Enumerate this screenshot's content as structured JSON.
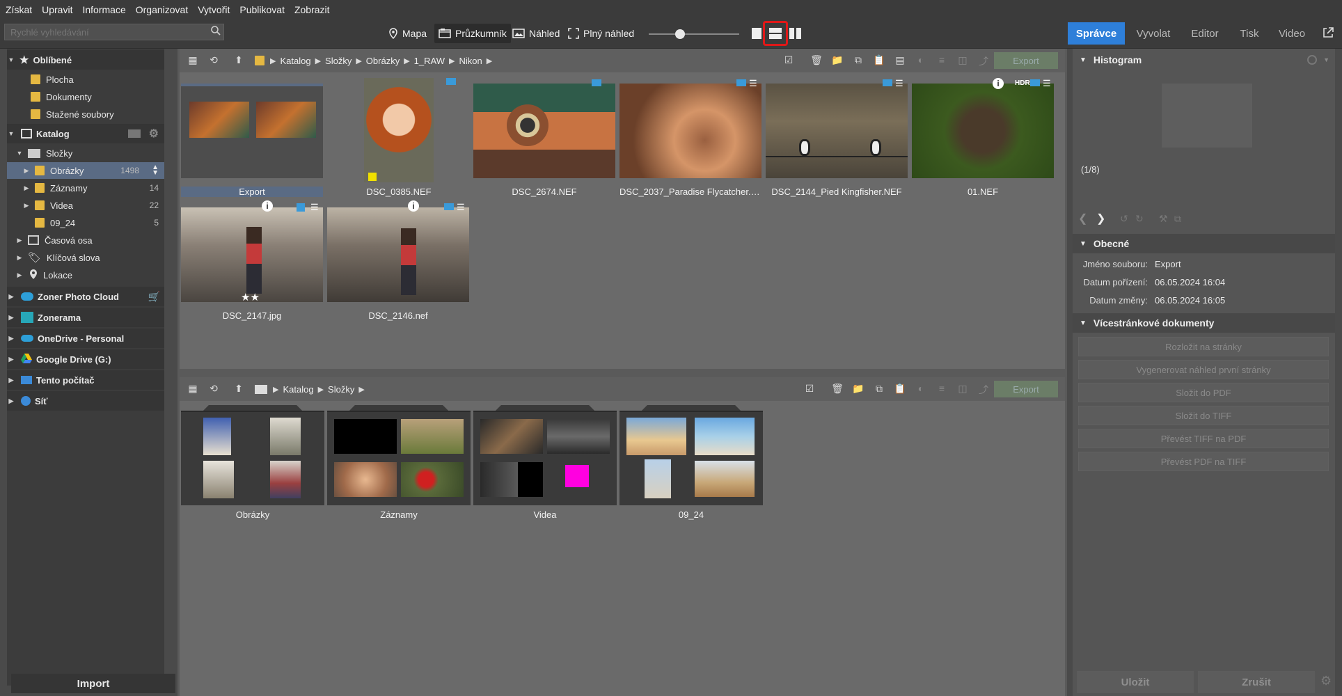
{
  "menu": [
    "Získat",
    "Upravit",
    "Informace",
    "Organizovat",
    "Vytvořit",
    "Publikovat",
    "Zobrazit"
  ],
  "search": {
    "placeholder": "Rychlé vyhledávání"
  },
  "modes": {
    "map": "Mapa",
    "explorer": "Průzkumník",
    "preview": "Náhled",
    "fullpreview": "Plný náhled"
  },
  "right_tabs": {
    "manager": "Správce",
    "develop": "Vyvolat",
    "editor": "Editor",
    "print": "Tisk",
    "video": "Video"
  },
  "sidebar": {
    "favorites": "Oblíbené",
    "fav_items": [
      "Plocha",
      "Dokumenty",
      "Stažené soubory"
    ],
    "catalog": "Katalog",
    "folders": "Složky",
    "images": "Obrázky",
    "images_count": "1498",
    "records": "Záznamy",
    "records_count": "14",
    "videos": "Videa",
    "videos_count": "22",
    "folder0924": "09_24",
    "folder0924_count": "5",
    "timeline": "Časová osa",
    "keywords": "Klíčová slova",
    "locations": "Lokace",
    "cloud": "Zoner Photo Cloud",
    "zonerama": "Zonerama",
    "onedrive": "OneDrive - Personal",
    "gdrive": "Google Drive (G:)",
    "thispc": "Tento počítač",
    "network": "Síť",
    "import": "Import"
  },
  "pane1": {
    "breadcrumb": [
      "Katalog",
      "Složky",
      "Obrázky",
      "1_RAW",
      "Nikon"
    ],
    "export": "Export",
    "items": [
      "Export",
      "DSC_0385.NEF",
      "DSC_2674.NEF",
      "DSC_2037_Paradise Flycatcher.N...",
      "DSC_2144_Pied Kingfisher.NEF",
      "01.NEF",
      "DSC_2147.jpg",
      "DSC_2146.nef"
    ]
  },
  "pane2": {
    "breadcrumb": [
      "Katalog",
      "Složky"
    ],
    "export": "Export",
    "folders": [
      "Obrázky",
      "Záznamy",
      "Videa",
      "09_24"
    ]
  },
  "info": {
    "histogram": "Histogram",
    "count": "(1/8)",
    "general": "Obecné",
    "filename_k": "Jméno souboru:",
    "filename_v": "Export",
    "taken_k": "Datum pořízení:",
    "taken_v": "06.05.2024 16:04",
    "changed_k": "Datum změny:",
    "changed_v": "06.05.2024 16:05",
    "multipage": "Vícestránkové dokumenty",
    "actions": [
      "Rozložit na stránky",
      "Vygenerovat náhled první stránky",
      "Složit do PDF",
      "Složit do TIFF",
      "Převést TIFF na PDF",
      "Převést PDF na TIFF"
    ],
    "save": "Uložit",
    "cancel": "Zrušit"
  },
  "badges": {
    "hdr": "HDR"
  }
}
